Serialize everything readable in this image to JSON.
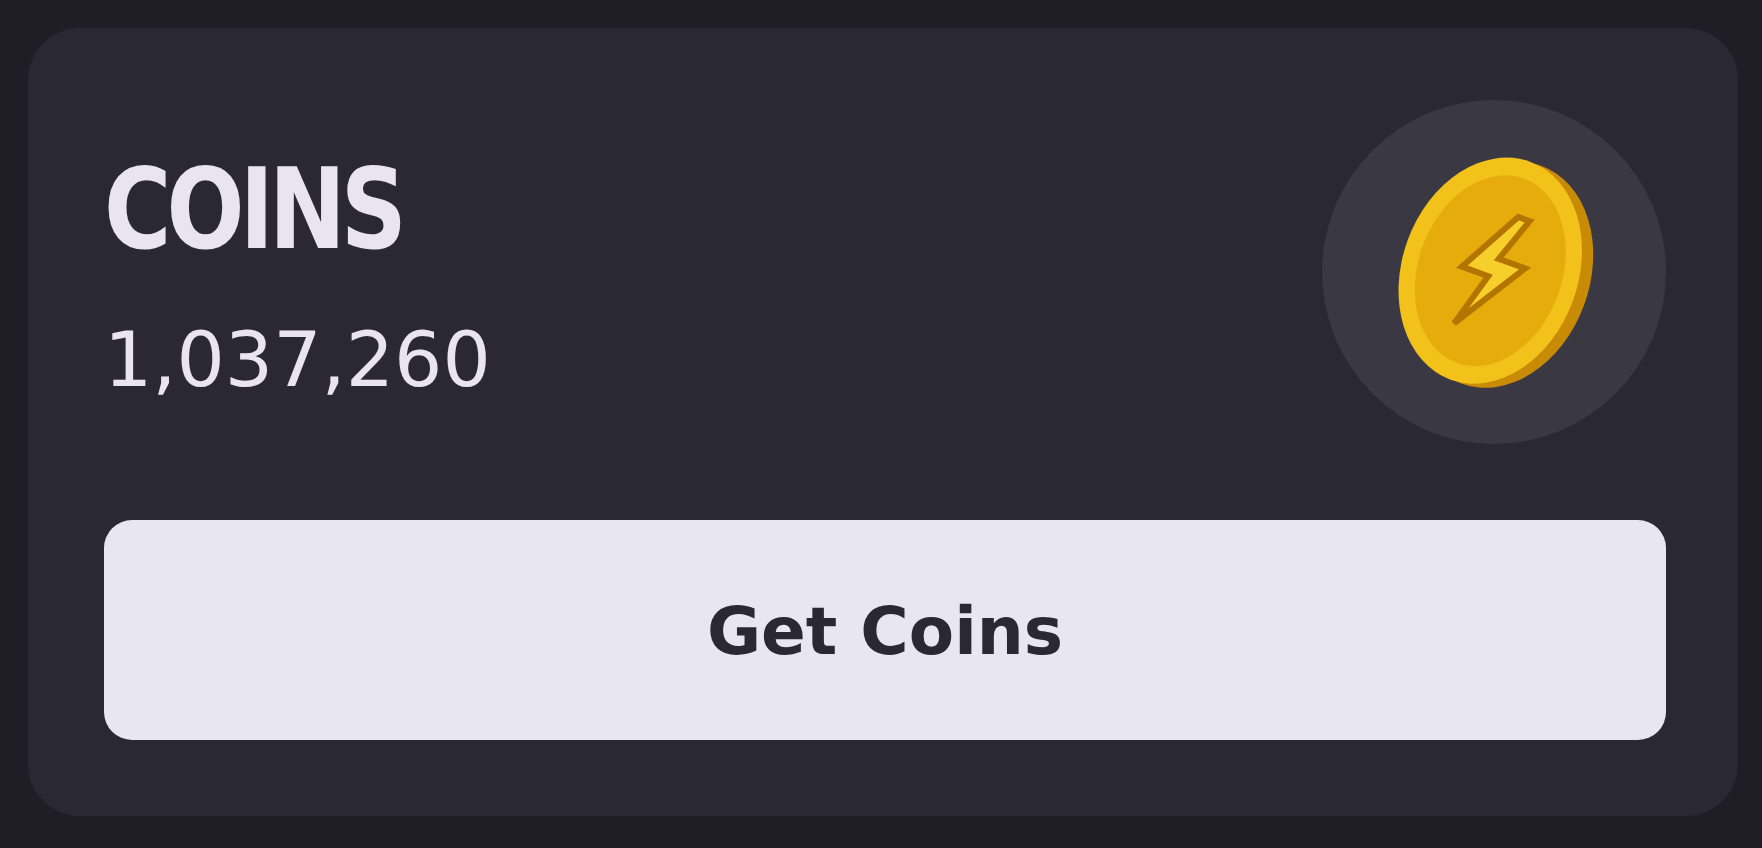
{
  "card": {
    "title": "COINS",
    "amount": "1,037,260",
    "button": "Get Coins"
  }
}
